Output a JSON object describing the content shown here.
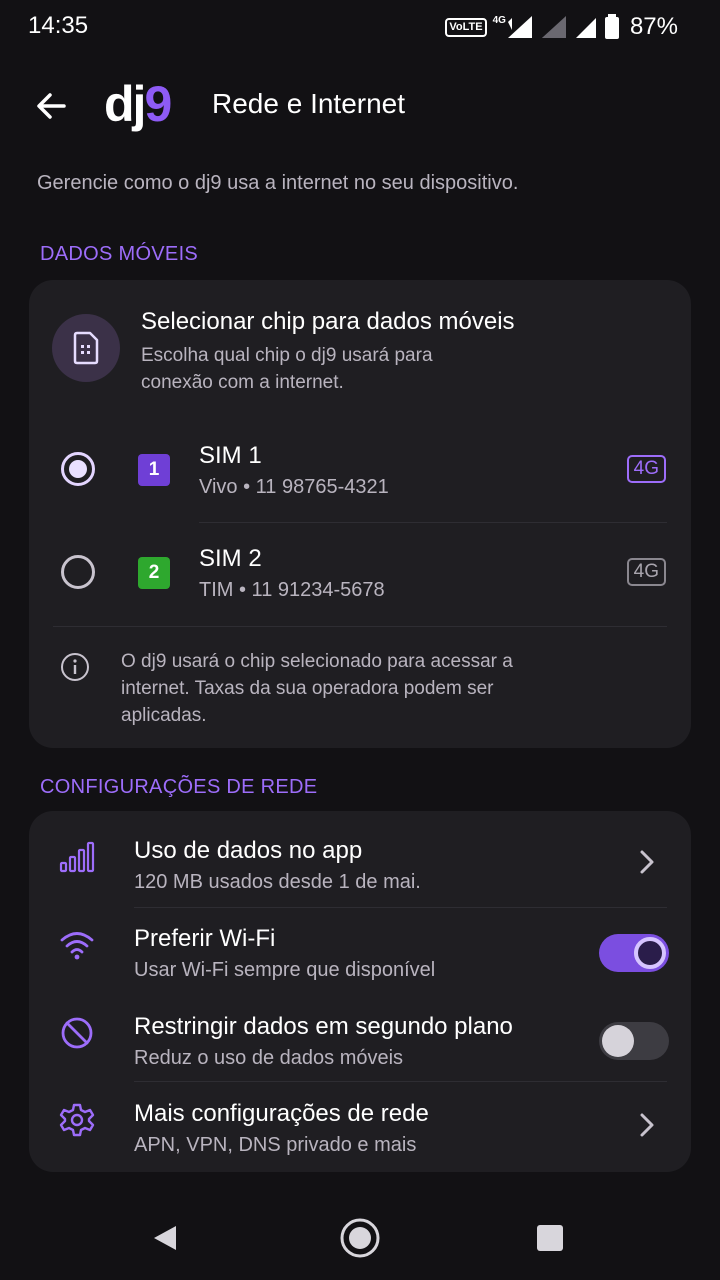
{
  "status_bar": {
    "time": "14:35",
    "volte": "VoLTE",
    "network": "4G",
    "battery": "87%"
  },
  "header": {
    "logo_prefix": "dj",
    "logo_suffix": "9",
    "title": "Rede e Internet"
  },
  "intro": "Gerencie como o dj9 usa a internet no seu dispositivo.",
  "mobile_data": {
    "section_label": "DADOS MÓVEIS",
    "chip_title": "Selecionar chip para dados móveis",
    "chip_desc": "Escolha qual chip o dj9 usará para conexão com a internet.",
    "sims": [
      {
        "slot": "1",
        "name": "SIM 1",
        "detail": "Vivo • 11 98765-4321",
        "network": "4G",
        "selected": true,
        "slot_color": "#6f3fd6",
        "badge_color": "#9d6dfa"
      },
      {
        "slot": "2",
        "name": "SIM 2",
        "detail": "TIM • 11 91234-5678",
        "network": "4G",
        "selected": false,
        "slot_color": "#2ea82e",
        "badge_color": "#a9a5ae"
      }
    ],
    "info_text": "O dj9 usará o chip selecionado para acessar a internet. Taxas da sua operadora podem ser aplicadas."
  },
  "network_settings": {
    "section_label": "CONFIGURAÇÕES DE REDE",
    "items": [
      {
        "title": "Uso de dados no app",
        "subtitle": "120 MB usados desde 1 de mai.",
        "icon": "signal-bars-icon",
        "control": "chevron"
      },
      {
        "title": "Preferir Wi-Fi",
        "subtitle": "Usar Wi-Fi sempre que disponível",
        "icon": "wifi-icon",
        "control": "toggle",
        "enabled": true
      },
      {
        "title": "Restringir dados em segundo plano",
        "subtitle": "Reduz o uso de dados móveis",
        "icon": "block-icon",
        "control": "toggle",
        "enabled": false
      },
      {
        "title": "Mais configurações de rede",
        "subtitle": "APN, VPN, DNS privado e mais",
        "icon": "gear-icon",
        "control": "chevron"
      }
    ]
  },
  "colors": {
    "accent": "#9d6dfa",
    "background": "#121114",
    "card": "#1f1e22"
  }
}
